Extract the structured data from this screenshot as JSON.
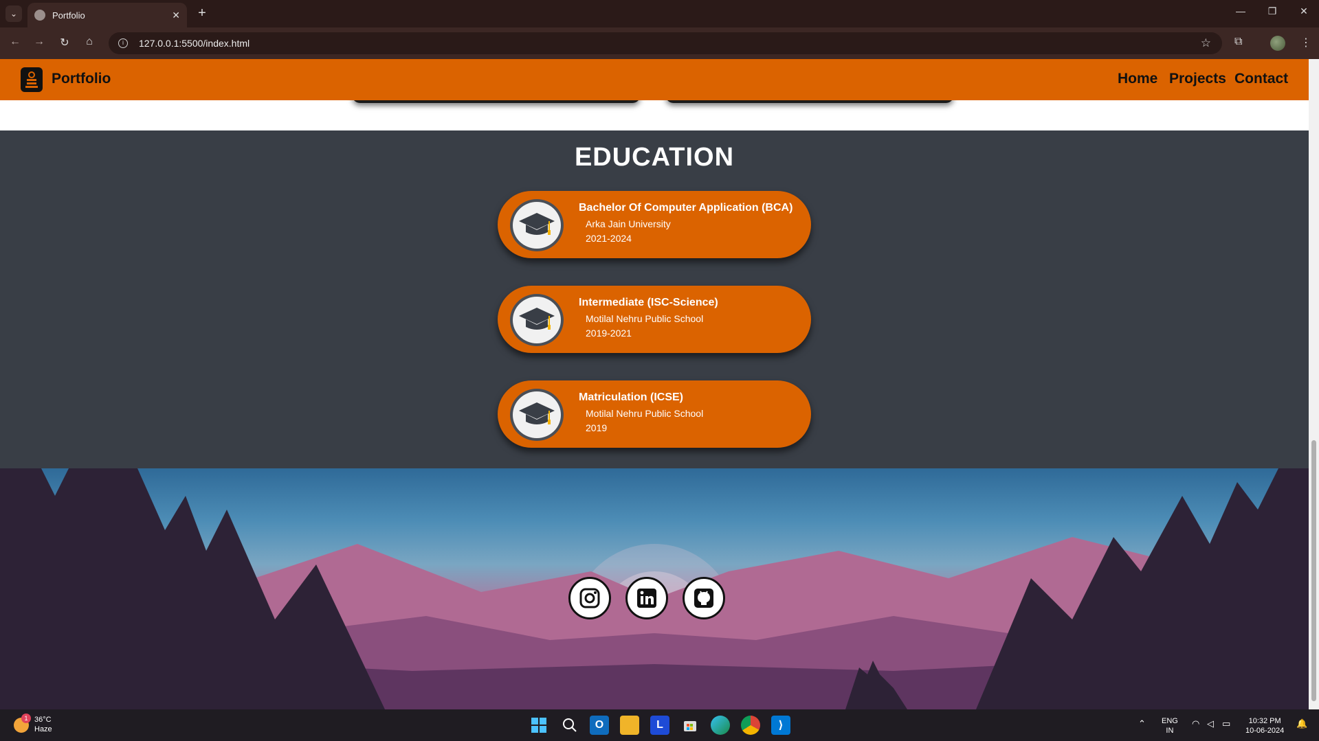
{
  "browser": {
    "tab_title": "Portfolio",
    "url": "127.0.0.1:5500/index.html"
  },
  "site": {
    "brand": "Portfolio",
    "nav": {
      "home": "Home",
      "projects": "Projects",
      "contact": "Contact"
    },
    "section_title": "EDUCATION",
    "education": [
      {
        "degree": "Bachelor Of Computer Application (BCA)",
        "school": "Arka Jain University",
        "years": "2021-2024"
      },
      {
        "degree": "Intermediate (ISC-Science)",
        "school": "Motilal Nehru Public School",
        "years": "2019-2021"
      },
      {
        "degree": "Matriculation (ICSE)",
        "school": "Motilal Nehru Public School",
        "years": "2019"
      }
    ],
    "social": [
      "instagram-icon",
      "linkedin-icon",
      "github-icon"
    ]
  },
  "taskbar": {
    "weather_temp": "36°C",
    "weather_desc": "Haze",
    "weather_badge": "1",
    "lang_top": "ENG",
    "lang_bottom": "IN",
    "time": "10:32 PM",
    "date": "10-06-2024"
  },
  "colors": {
    "accent": "#db6300",
    "section_bg": "#393e46"
  }
}
